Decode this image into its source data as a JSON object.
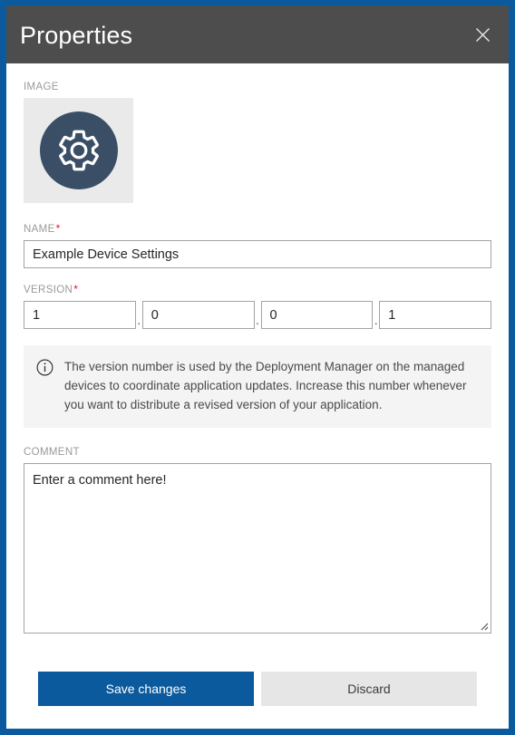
{
  "window": {
    "border_color": "#0c5a9e",
    "titlebar_color": "#4d4d4d"
  },
  "titlebar": {
    "title": "Properties",
    "close_icon": "close-icon"
  },
  "form": {
    "image": {
      "label": "IMAGE",
      "icon": "gear-icon",
      "icon_circle_color": "#3a4f66",
      "placeholder_bg": "#eaeaea"
    },
    "name": {
      "label": "NAME",
      "required_marker": "*",
      "value": "Example Device Settings",
      "placeholder": ""
    },
    "version": {
      "label": "VERSION",
      "required_marker": "*",
      "separator": ".",
      "parts": [
        {
          "name": "major",
          "value": "1"
        },
        {
          "name": "minor",
          "value": "0"
        },
        {
          "name": "build",
          "value": "0"
        },
        {
          "name": "revision",
          "value": "1"
        }
      ]
    },
    "info": {
      "icon": "info-icon",
      "text": "The version number is used by the Deployment Manager on the managed devices to coordinate application updates. Increase this number whenever you want to distribute a revised version of your application."
    },
    "comment": {
      "label": "COMMENT",
      "value": "Enter a comment here!",
      "placeholder": "Enter a comment here!"
    }
  },
  "footer": {
    "save_label": "Save changes",
    "discard_label": "Discard",
    "save_color": "#0c5a9e",
    "discard_color": "#e6e6e6"
  }
}
